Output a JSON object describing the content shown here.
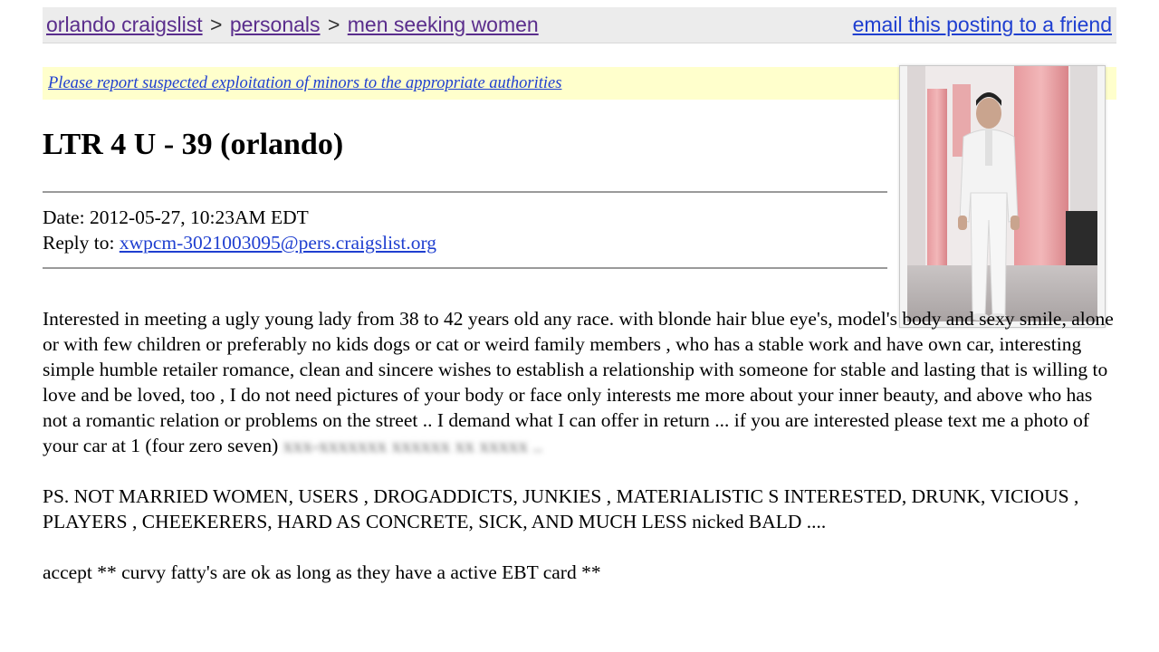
{
  "breadcrumb": {
    "site": "orlando craigslist",
    "sep1": ">",
    "section": "personals",
    "sep2": ">",
    "category": "men seeking women",
    "email_link": "email this posting to a friend"
  },
  "warning": {
    "text": "Please report suspected exploitation of minors to the appropriate authorities"
  },
  "posting": {
    "title": "LTR 4 U - 39 (orlando)",
    "date_label": "Date:",
    "date_value": "2012-05-27, 10:23AM EDT",
    "reply_label": "Reply to:",
    "reply_email": "xwpcm-3021003095@pers.craigslist.org",
    "body_main": "Interested in meeting a ugly young lady from 38 to 42 years old any race. with blonde hair blue eye's, model's body and sexy smile, alone or with few children or preferably no kids dogs or cat or weird family members , who has a stable work and have own car, interesting simple humble retailer romance, clean and sincere wishes to establish a relationship with someone for stable and lasting that is willing to love and be loved, too , I do not need pictures of your body or face only interests me more about your inner beauty, and above who has not a romantic relation or problems on the street .. I demand what I can offer in return ... if you are interested please text me a photo of your car at 1 (four zero seven)",
    "body_blurred": "xxx-xxxxxxx xxxxxx xx xxxxx ..",
    "ps": "PS. NOT MARRIED WOMEN, USERS , DROGADDICTS, JUNKIES , MATERIALISTIC S INTERESTED, DRUNK, VICIOUS , PLAYERS , CHEEKERERS, HARD AS CONCRETE, SICK, AND MUCH LESS nicked BALD ....",
    "accept": "accept ** curvy fatty's are ok as long as they have a active EBT card **"
  },
  "colors": {
    "visited_link": "#5a2d8c",
    "link": "#1f3fd0",
    "warning_bg": "#ffffcc",
    "crumb_bg": "#ececec"
  }
}
